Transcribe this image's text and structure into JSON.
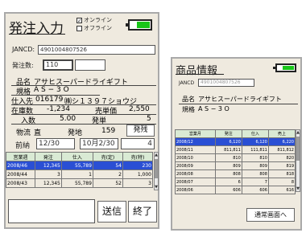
{
  "left": {
    "title": "発注入力",
    "online_label": "オンライン",
    "offline_label": "オフライン",
    "online_checked": "✓",
    "jancd_label": "JANCD:",
    "jancd_value": "4901004807526",
    "qty_label": "発注数:",
    "qty_value": "110",
    "name_label": "品名",
    "name_value": "アサヒスーパードライギフト",
    "spec_label": "規格",
    "spec_value": "A S − 3 O",
    "supplier_label": "仕入先",
    "supplier_code": "016179",
    "supplier_name": "㈱シ１３９７ショウジ",
    "stock_label": "在庫数",
    "stock_value": "-1,234",
    "sales_price_label": "売単価",
    "sales_price_value": "2,550",
    "case_label": "入数",
    "case_value": "5.00",
    "unit_label": "発単",
    "unit_value": "5",
    "dist_label": "物流",
    "dist_value": "直",
    "order_place_label": "発地",
    "order_place_value": "159",
    "order_button": "発残",
    "prev_label": "前納",
    "prev_date_from": "12/30",
    "prev_date_to": "10月2/30",
    "prev_count": "4",
    "table": {
      "headers": [
        "営業週",
        "発注",
        "仕入",
        "売(定)",
        "売(特)"
      ],
      "rows": [
        [
          "2008/46",
          "12,345",
          "55,789",
          "54",
          "230"
        ],
        [
          "2008/44",
          "3",
          "1",
          "2",
          "1,000"
        ],
        [
          "2008/43",
          "12,345",
          "55,789",
          "52",
          "3"
        ]
      ]
    },
    "send_button": "送信",
    "end_button": "終了"
  },
  "right": {
    "title": "商品情報",
    "jancd_label": "JANCD",
    "jancd_value": "4901004807526",
    "name_label": "品名",
    "name_value": "アサヒスーパードライギフト",
    "spec_label": "規格",
    "spec_value": "A S − 3 O",
    "table": {
      "headers": [
        "営業月",
        "発注",
        "仕入",
        "売上"
      ],
      "rows": [
        [
          "2008/12",
          "6,120",
          "6,120",
          "6,220"
        ],
        [
          "2008/11",
          "811,811",
          "111,811",
          "811,812"
        ],
        [
          "2008/10",
          "810",
          "810",
          "820"
        ],
        [
          "2008/09",
          "809",
          "809",
          "819"
        ],
        [
          "2008/08",
          "808",
          "808",
          "818"
        ],
        [
          "2008/07",
          "6",
          "7",
          "8"
        ],
        [
          "2008/06",
          "606",
          "606",
          "616"
        ]
      ]
    },
    "back_button": "通常画面へ"
  },
  "colors": {
    "panel": "#efeadf",
    "battery": "#19c619",
    "selected_row": "#2a4fd4",
    "header": "#d9ead4"
  }
}
